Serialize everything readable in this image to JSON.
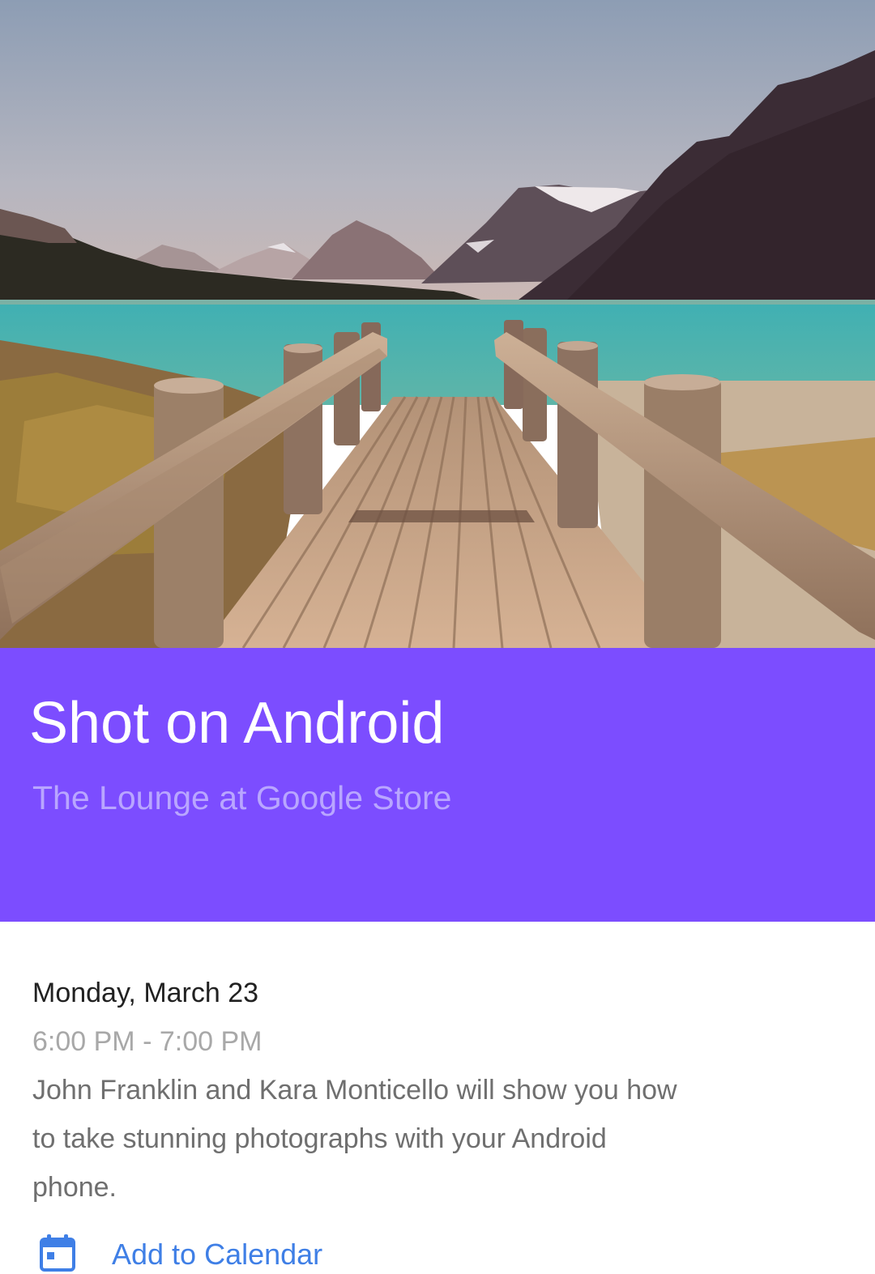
{
  "hero": {
    "image_subject": "wooden-bridge-mountain-lake-photo"
  },
  "event": {
    "title": "Shot on Android",
    "location": "The Lounge at Google Store",
    "date": "Monday, March 23",
    "time": "6:00 PM - 7:00 PM",
    "description": "John Franklin and Kara Monticello will show you how to take stunning photographs with your Android phone."
  },
  "actions": {
    "add_to_calendar_label": "Add to Calendar",
    "add_to_calendar_icon": "calendar-icon"
  },
  "colors": {
    "header_background": "#7c4dff",
    "title_text": "#ffffff",
    "location_text": "#b9a6ff",
    "action_blue": "#3f7fe6"
  }
}
